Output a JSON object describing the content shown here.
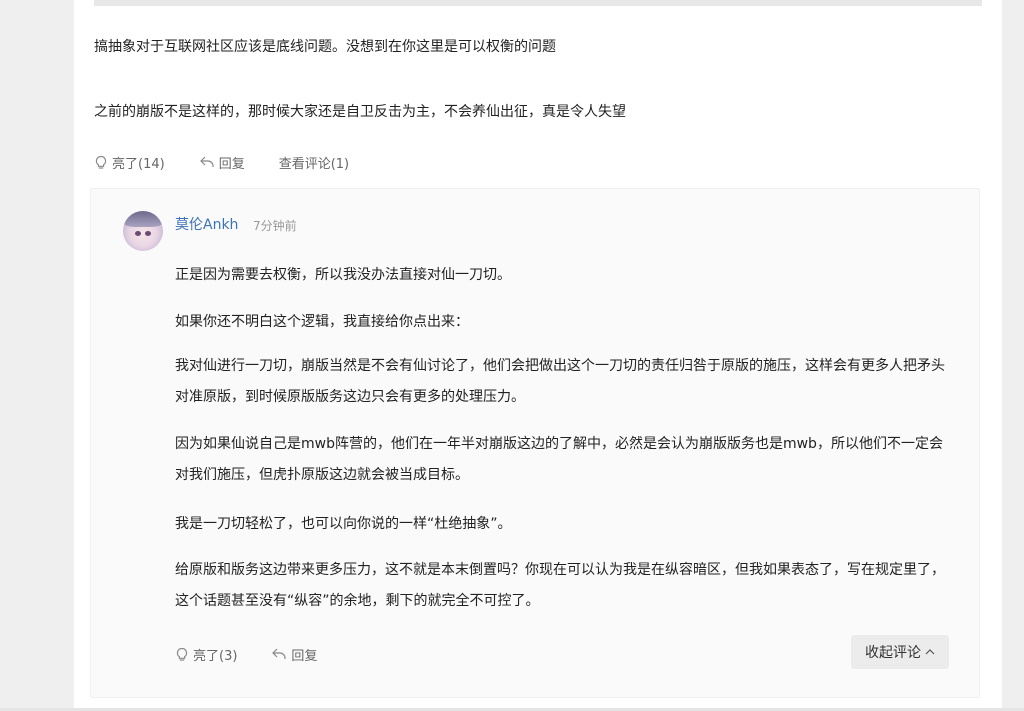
{
  "post": {
    "line1": "搞抽象对于互联网社区应该是底线问题。没想到在你这里是可以权衡的问题",
    "line2": "之前的崩版不是这样的，那时候大家还是自卫反击为主，不会养仙出征，真是令人失望",
    "actions": {
      "like_label": "亮了(14)",
      "reply_label": "回复",
      "view_comments_label": "查看评论(1)"
    }
  },
  "reply": {
    "avatar_icon": "avatar-image",
    "username": "莫伦Ankh",
    "timestamp": "7分钟前",
    "paragraphs": [
      "正是因为需要去权衡，所以我没办法直接对仙一刀切。",
      "如果你还不明白这个逻辑，我直接给你点出来：",
      "我对仙进行一刀切，崩版当然是不会有仙讨论了，他们会把做出这个一刀切的责任归咎于原版的施压，这样会有更多人把矛头对准原版，到时候原版版务这边只会有更多的处理压力。",
      "因为如果仙说自己是mwb阵营的，他们在一年半对崩版这边的了解中，必然是会认为崩版版务也是mwb，所以他们不一定会对我们施压，但虎扑原版这边就会被当成目标。",
      "我是一刀切轻松了，也可以向你说的一样“杜绝抽象”。",
      "给原版和版务这边带来更多压力，这不就是本末倒置吗？你现在可以认为我是在纵容暗区，但我如果表态了，写在规定里了，这个话题甚至没有“纵容”的余地，剩下的就完全不可控了。"
    ],
    "actions": {
      "like_label": "亮了(3)",
      "reply_label": "回复",
      "collapse_label": "收起评论"
    }
  },
  "colors": {
    "username": "#3c72b8",
    "panel_bg": "#fafafa",
    "button_bg": "#ececec"
  }
}
